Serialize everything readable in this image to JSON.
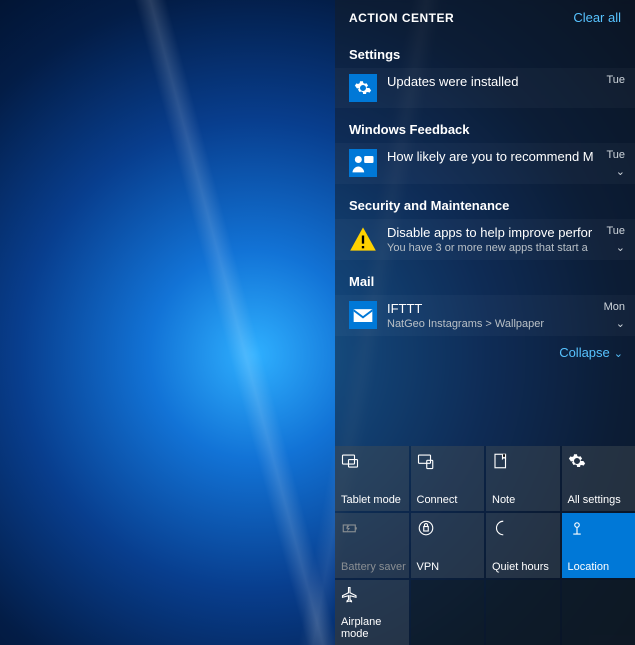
{
  "header": {
    "title": "ACTION CENTER",
    "clear_all": "Clear all"
  },
  "groups": [
    {
      "title": "Settings",
      "items": [
        {
          "icon": "gear-icon",
          "title": "Updates were installed",
          "subtitle": "",
          "time": "Tue",
          "expandable": false
        }
      ]
    },
    {
      "title": "Windows Feedback",
      "items": [
        {
          "icon": "feedback-icon",
          "title": "How likely are you to recommend M",
          "subtitle": "",
          "time": "Tue",
          "expandable": true
        }
      ]
    },
    {
      "title": "Security and Maintenance",
      "items": [
        {
          "icon": "warning-icon",
          "title": "Disable apps to help improve perfor",
          "subtitle": "You have 3 or more new apps that start a",
          "time": "Tue",
          "expandable": true
        }
      ]
    },
    {
      "title": "Mail",
      "items": [
        {
          "icon": "mail-icon",
          "title": "IFTTT",
          "subtitle": "NatGeo Instagrams > Wallpaper",
          "time": "Mon",
          "expandable": true
        }
      ]
    }
  ],
  "collapse_label": "Collapse",
  "tiles": [
    {
      "label": "Tablet mode",
      "icon": "tablet-icon",
      "state": "normal"
    },
    {
      "label": "Connect",
      "icon": "connect-icon",
      "state": "normal"
    },
    {
      "label": "Note",
      "icon": "note-icon",
      "state": "normal"
    },
    {
      "label": "All settings",
      "icon": "gear-icon",
      "state": "normal"
    },
    {
      "label": "Battery saver",
      "icon": "battery-icon",
      "state": "disabled"
    },
    {
      "label": "VPN",
      "icon": "vpn-icon",
      "state": "normal"
    },
    {
      "label": "Quiet hours",
      "icon": "moon-icon",
      "state": "normal"
    },
    {
      "label": "Location",
      "icon": "location-icon",
      "state": "active"
    },
    {
      "label": "Airplane mode",
      "icon": "airplane-icon",
      "state": "normal"
    }
  ],
  "colors": {
    "accent": "#0078d7",
    "link": "#57c3ff"
  }
}
